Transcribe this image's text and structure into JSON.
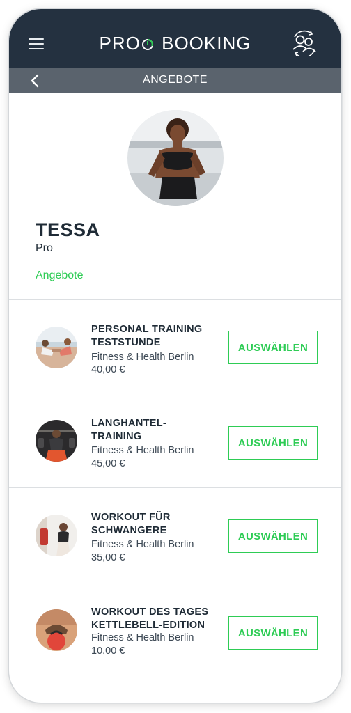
{
  "header": {
    "logo_left": "PRO",
    "logo_right": "BOOKING",
    "menu_icon": "hamburger-menu-icon",
    "switch_icon": "users-swap-icon"
  },
  "subheader": {
    "title": "ANGEBOTE",
    "back_icon": "chevron-left-icon"
  },
  "profile": {
    "name": "TESSA",
    "role": "Pro",
    "section_label": "Angebote"
  },
  "offers": [
    {
      "title_line1": "PERSONAL TRAINING",
      "title_line2": "TESTSTUNDE",
      "studio": "Fitness & Health Berlin",
      "price": "40,00 €",
      "button": "AUSWÄHLEN"
    },
    {
      "title_line1": "LANGHANTEL-",
      "title_line2": "TRAINING",
      "studio": "Fitness & Health Berlin",
      "price": "45,00 €",
      "button": "AUSWÄHLEN"
    },
    {
      "title_line1": "WORKOUT FÜR",
      "title_line2": "SCHWANGERE",
      "studio": "Fitness & Health Berlin",
      "price": "35,00 €",
      "button": "AUSWÄHLEN"
    },
    {
      "title_line1": "WORKOUT DES TAGES",
      "title_line2": "KETTLEBELL-EDITION",
      "studio": "Fitness & Health Berlin",
      "price": "10,00 €",
      "button": "AUSWÄHLEN"
    }
  ],
  "colors": {
    "header_bg": "#243140",
    "subheader_bg": "#5a636d",
    "accent": "#2ecc55",
    "text_dark": "#1f2b36"
  }
}
